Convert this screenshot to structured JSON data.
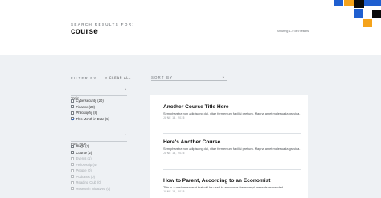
{
  "header": {
    "search_label": "SEARCH RESULTS FOR:",
    "search_term": "course",
    "showing_text": "Showing 1–9 of 9 results"
  },
  "toolbar": {
    "filter_by": "FILTER BY",
    "clear_all": "× CLEAR ALL",
    "sort_by": "SORT BY",
    "sort_selected": ""
  },
  "filters": {
    "topic": {
      "title": "Topic",
      "options": [
        {
          "label": "Cybersecurity (20)",
          "checked": false
        },
        {
          "label": "Finance (23)",
          "checked": false
        },
        {
          "label": "Philosophy (8)",
          "checked": false
        },
        {
          "label": "This Month in Data (5)",
          "checked": true
        }
      ]
    },
    "post_type": {
      "title": "Post Type",
      "options": [
        {
          "label": "Blogs (2)",
          "enabled": true
        },
        {
          "label": "Course (2)",
          "enabled": true
        },
        {
          "label": "Events (1)",
          "enabled": false
        },
        {
          "label": "Fellowship (4)",
          "enabled": false
        },
        {
          "label": "People (0)",
          "enabled": false
        },
        {
          "label": "Podcasts (0)",
          "enabled": false
        },
        {
          "label": "Reading Club (0)",
          "enabled": false
        },
        {
          "label": "Research Initiatives (0)",
          "enabled": false
        }
      ]
    }
  },
  "results": [
    {
      "title": "Another Course Title Here",
      "excerpt": "Sem pharetra non adipiscing dui, vitae fermentum facilisi pretium. Magna amet malesuada gravida.",
      "date": "JUNE 15, 2025"
    },
    {
      "title": "Here's Another Course",
      "excerpt": "Sem pharetra non adipiscing dui, vitae fermentum facilisi pretium. Magna amet malesuada gravida.",
      "date": "JUNE 15, 2025"
    },
    {
      "title": "How to Parent, According to an Economist",
      "excerpt": "This is a custom excerpt that will be used to announce the excerpt presents as needed.",
      "date": "JUNE 15, 2025"
    }
  ],
  "colors": {
    "accent_blue": "#1f5fd0",
    "accent_orange": "#f5a31b",
    "background_panel": "#eef1f4"
  }
}
